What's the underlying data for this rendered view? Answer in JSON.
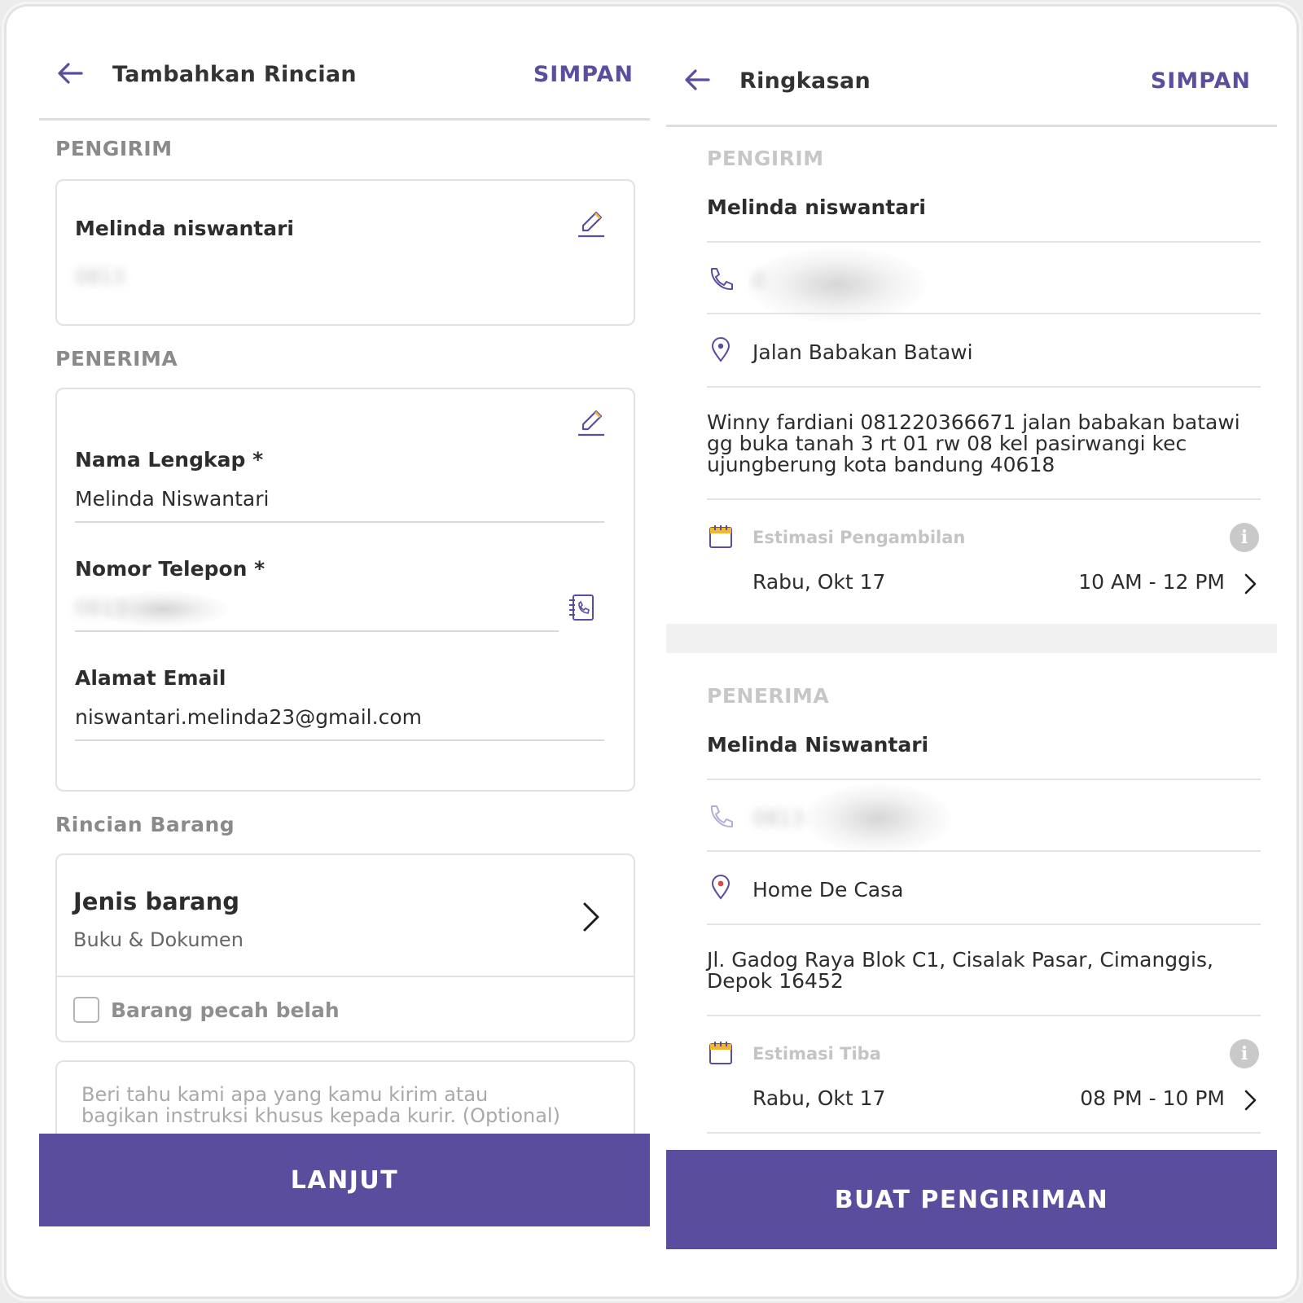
{
  "left": {
    "header": {
      "title": "Tambahkan Rincian",
      "save_label": "SIMPAN"
    },
    "sender": {
      "section_label": "PENGIRIM",
      "name": "Melinda niswantari",
      "phone": "0813"
    },
    "recipient": {
      "section_label": "PENERIMA",
      "name_label": "Nama Lengkap *",
      "name_value": "Melinda Niswantari",
      "phone_label": "Nomor Telepon *",
      "phone_value": "0813",
      "email_label": "Alamat Email",
      "email_value": "niswantari.melinda23@gmail.com"
    },
    "items": {
      "section_label": "Rincian Barang",
      "type_label": "Jenis barang",
      "type_value": "Buku & Dokumen",
      "fragile_label": "Barang pecah belah",
      "notes_placeholder_line1": "Beri tahu kami apa yang kamu kirim atau",
      "notes_placeholder_line2": "bagikan instruksi khusus kepada kurir. (Optional)"
    },
    "continue_label": "LANJUT"
  },
  "right": {
    "header": {
      "title": "Ringkasan",
      "save_label": "SIMPAN"
    },
    "sender": {
      "section_label": "PENGIRIM",
      "name": "Melinda niswantari",
      "phone": "0",
      "location": "Jalan Babakan Batawi",
      "address_line1": "Winny fardiani 081220366671 jalan babakan batawi",
      "address_line2": "gg buka tanah 3 rt 01 rw 08 kel pasirwangi kec",
      "address_line3": "ujungberung kota bandung 40618",
      "estimate_label": "Estimasi Pengambilan",
      "estimate_date": "Rabu, Okt 17",
      "estimate_time": "10 AM - 12 PM"
    },
    "recipient": {
      "section_label": "PENERIMA",
      "name": "Melinda Niswantari",
      "phone": "0813",
      "location": "Home De Casa",
      "address_line1": "Jl. Gadog Raya Blok C1, Cisalak Pasar, Cimanggis,",
      "address_line2": "Depok 16452",
      "estimate_label": "Estimasi Tiba",
      "estimate_date": "Rabu, Okt 17",
      "estimate_time": "08 PM - 10 PM"
    },
    "create_label": "BUAT PENGIRIMAN"
  },
  "colors": {
    "accent": "#5a4d9e",
    "pin_red": "#e0454b",
    "calendar_yellow": "#f2b632"
  }
}
